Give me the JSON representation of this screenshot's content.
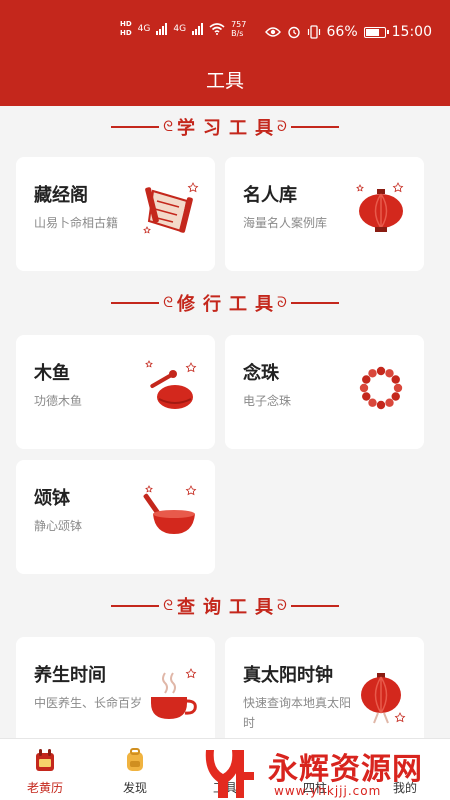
{
  "status_bar": {
    "hd_top": "HD",
    "hd_bottom": "HD",
    "net1": "4G",
    "net2": "4G",
    "speed_value": "757",
    "speed_unit": "B/s",
    "battery_percent": "66%",
    "time": "15:00"
  },
  "header": {
    "title": "工具"
  },
  "sections": {
    "learn": "学习工具",
    "practice": "修行工具",
    "query": "查询工具"
  },
  "cards": {
    "cangjingge": {
      "title": "藏经阁",
      "subtitle": "山易卜命相古籍"
    },
    "mingrenku": {
      "title": "名人库",
      "subtitle": "海量名人案例库"
    },
    "muyu": {
      "title": "木鱼",
      "subtitle": "功德木鱼"
    },
    "nianzhu": {
      "title": "念珠",
      "subtitle": "电子念珠"
    },
    "songbo": {
      "title": "颂钵",
      "subtitle": "静心颂钵"
    },
    "yangsheng": {
      "title": "养生时间",
      "subtitle": "中医养生、长命百岁"
    },
    "zhentaiyang": {
      "title": "真太阳时钟",
      "subtitle": "快速查询本地真太阳时"
    }
  },
  "tabbar": {
    "items": [
      {
        "label": "老黄历",
        "active": true
      },
      {
        "label": "发现",
        "active": false
      },
      {
        "label": "工具",
        "active": false
      },
      {
        "label": "四柱",
        "active": false
      },
      {
        "label": "我的",
        "active": false
      }
    ]
  },
  "watermark": {
    "text": "永辉资源网",
    "url": "www.yhkjjj.com"
  },
  "colors": {
    "brand_red": "#c4271c",
    "page_bg": "#f4f4f4"
  }
}
